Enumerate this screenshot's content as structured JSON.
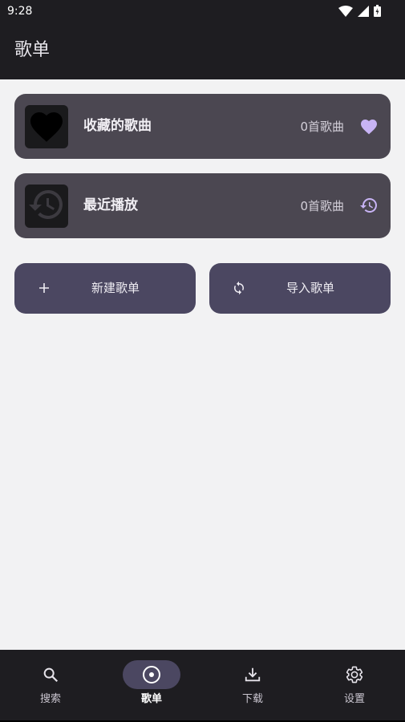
{
  "status_bar": {
    "time": "9:28"
  },
  "app_bar": {
    "title": "歌单"
  },
  "playlists": [
    {
      "title": "收藏的歌曲",
      "count": "0首歌曲",
      "icon": "heart-icon",
      "cover": "heart-cover"
    },
    {
      "title": "最近播放",
      "count": "0首歌曲",
      "icon": "history-icon",
      "cover": "history-cover"
    }
  ],
  "actions": {
    "new_playlist": {
      "label": "新建歌单",
      "icon": "plus-icon"
    },
    "import_playlist": {
      "label": "导入歌单",
      "icon": "sync-icon"
    }
  },
  "bottom_nav": {
    "active": "歌单",
    "items": [
      {
        "label": "搜索",
        "icon": "search-icon"
      },
      {
        "label": "歌单",
        "icon": "disc-icon"
      },
      {
        "label": "下载",
        "icon": "download-icon"
      },
      {
        "label": "设置",
        "icon": "settings-icon"
      }
    ]
  },
  "colors": {
    "bar_background": "#1e1d21",
    "page_background": "#f2f2f3",
    "card_background": "#4b4751",
    "button_background": "#4b4761",
    "accent": "#c8b4f5"
  }
}
